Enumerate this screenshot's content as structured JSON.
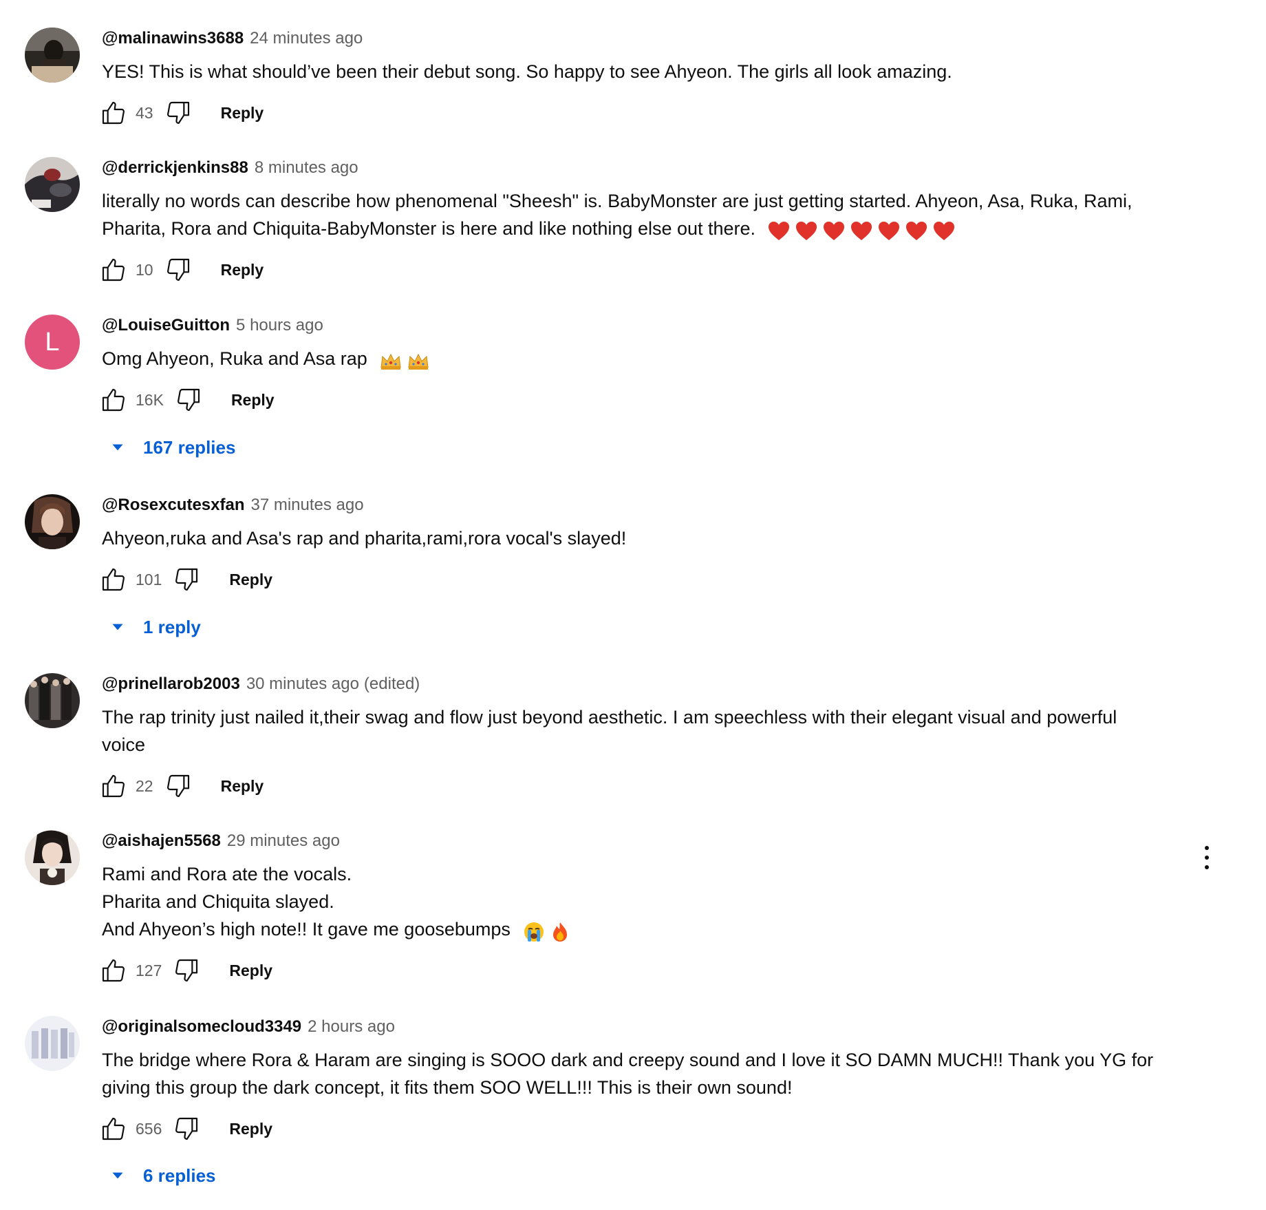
{
  "comments": [
    {
      "author": "@malinawins3688",
      "time": "24 minutes ago",
      "body": [
        "YES! This is what should’ve been their debut song. So happy to see Ahyeon. The girls all look amazing."
      ],
      "likes": "43",
      "reply_label": "Reply"
    },
    {
      "author": "@derrickjenkins88",
      "time": "8 minutes ago",
      "body": [
        "literally no words can describe how phenomenal \"Sheesh\" is.  BabyMonster are just getting started.   Ahyeon, Asa, Ruka, Rami,",
        "Pharita, Rora and Chiquita-BabyMonster is here and like nothing else out there."
      ],
      "likes": "10",
      "reply_label": "Reply"
    },
    {
      "author": "@LouiseGuitton",
      "time": "5 hours ago",
      "avatar_letter": "L",
      "body": [
        "Omg Ahyeon, Ruka and Asa rap"
      ],
      "likes": "16K",
      "reply_label": "Reply",
      "replies": "167 replies"
    },
    {
      "author": "@Rosexcutesxfan",
      "time": "37 minutes ago",
      "body": [
        "Ahyeon,ruka and Asa's rap and pharita,rami,rora vocal's slayed!"
      ],
      "likes": "101",
      "reply_label": "Reply",
      "replies": "1 reply"
    },
    {
      "author": "@prinellarob2003",
      "time": "30 minutes ago",
      "edited": "(edited)",
      "body": [
        "The rap trinity just nailed it,their swag and flow just beyond aesthetic. I am speechless with their elegant visual and powerful",
        "voice"
      ],
      "likes": "22",
      "reply_label": "Reply"
    },
    {
      "author": "@aishajen5568",
      "time": "29 minutes ago",
      "body": [
        "Rami and Rora ate the vocals.",
        "Pharita and Chiquita slayed.",
        "And Ahyeon’s high note!! It gave me goosebumps"
      ],
      "likes": "127",
      "reply_label": "Reply"
    },
    {
      "author": "@originalsomecloud3349",
      "time": "2 hours ago",
      "body": [
        "The bridge where Rora & Haram are singing is SOOO dark and creepy sound and I love it SO DAMN MUCH!! Thank you YG for",
        "giving this group the dark concept, it fits them SOO WELL!!! This is their own sound!"
      ],
      "likes": "656",
      "reply_label": "Reply",
      "replies": "6 replies"
    }
  ],
  "icons": {
    "like": "thumb-up-icon",
    "dislike": "thumb-down-icon",
    "expand": "caret-down-icon",
    "menu": "more-vert-icon",
    "heart_emoji": "red-heart-emoji",
    "crown_emoji": "crown-emoji",
    "crying_emoji": "loudly-crying-face-emoji",
    "fire_emoji": "fire-emoji"
  },
  "colors": {
    "text": "#0f0f0f",
    "secondary_text": "#606060",
    "link_blue": "#065fd4",
    "louise_avatar": "#e2527a"
  }
}
